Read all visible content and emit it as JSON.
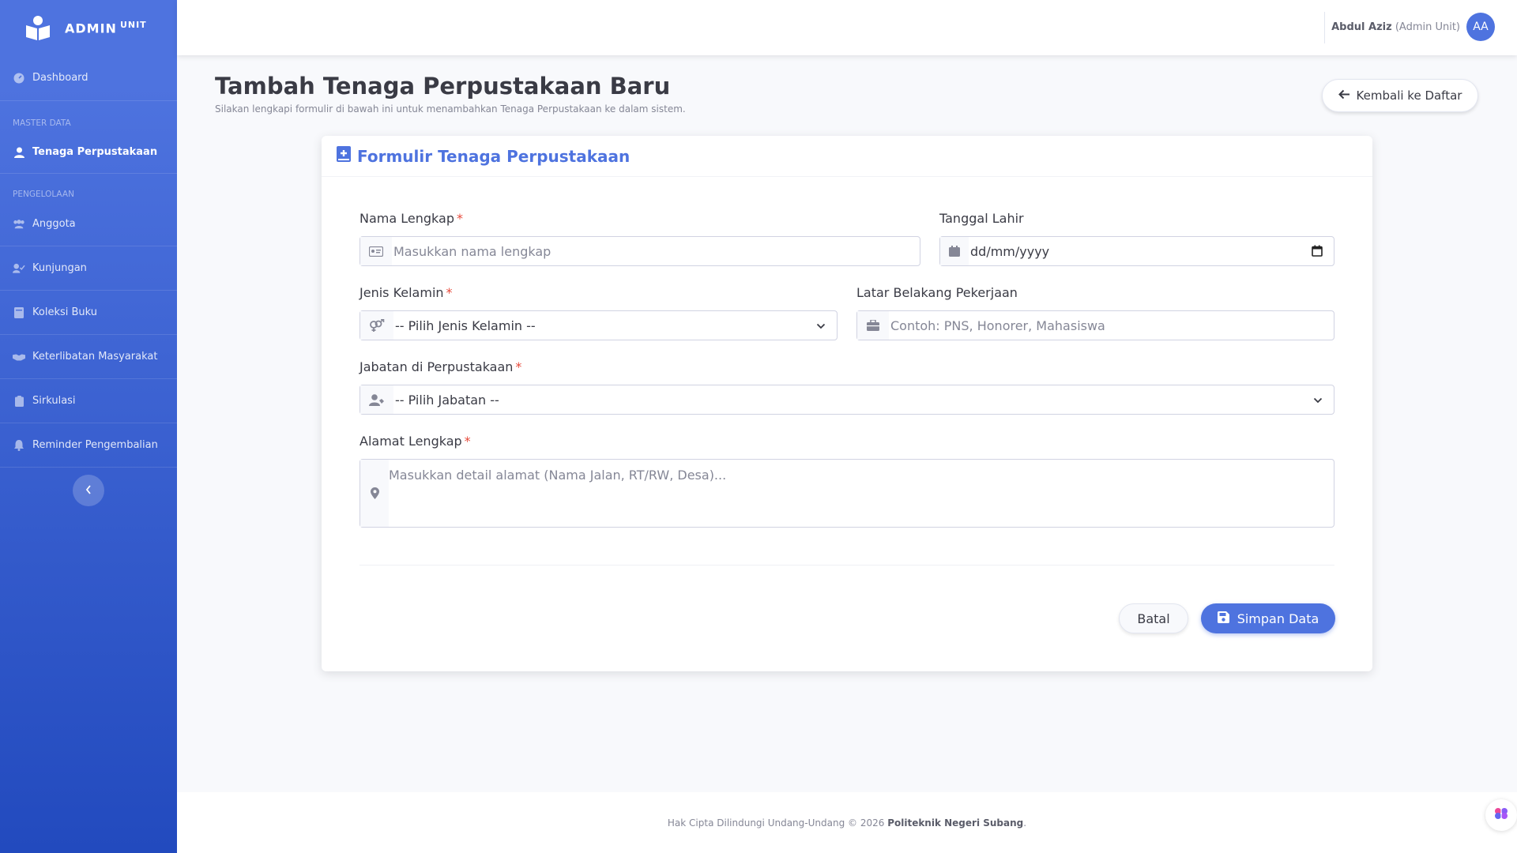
{
  "brand": {
    "name": "ADMIN",
    "suffix": "UNIT",
    "icon": "book-reader-icon"
  },
  "sidebar": {
    "dashboard": "Dashboard",
    "section_master": "MASTER DATA",
    "tenaga": "Tenaga Perpustakaan",
    "section_pengelolaan": "PENGELOLAAN",
    "items": [
      {
        "label": "Anggota",
        "icon": "users-icon"
      },
      {
        "label": "Kunjungan",
        "icon": "user-check-icon"
      },
      {
        "label": "Koleksi Buku",
        "icon": "book-icon"
      },
      {
        "label": "Keterlibatan Masyarakat",
        "icon": "handshake-icon"
      },
      {
        "label": "Sirkulasi",
        "icon": "clipboard-icon"
      },
      {
        "label": "Reminder Pengembalian",
        "icon": "bell-icon"
      }
    ],
    "toggle_icon": "chevron-left-icon"
  },
  "topbar": {
    "user_name": "Abdul Aziz",
    "user_role": "(Admin Unit)",
    "avatar_initials": "AA"
  },
  "page": {
    "title": "Tambah Tenaga Perpustakaan Baru",
    "subtitle": "Silakan lengkapi formulir di bawah ini untuk menambahkan Tenaga Perpustakaan ke dalam sistem.",
    "back_label": "Kembali ke Daftar"
  },
  "form": {
    "title": "Formulir Tenaga Perpustakaan",
    "nama_label": "Nama Lengkap",
    "nama_placeholder": "Masukkan nama lengkap",
    "tanggal_label": "Tanggal Lahir",
    "tanggal_placeholder": "dd/mm/yyyy",
    "jk_label": "Jenis Kelamin",
    "jk_value": "-- Pilih Jenis Kelamin --",
    "pekerjaan_label": "Latar Belakang Pekerjaan",
    "pekerjaan_placeholder": "Contoh: PNS, Honorer, Mahasiswa",
    "jabatan_label": "Jabatan di Perpustakaan",
    "jabatan_value": "-- Pilih Jabatan --",
    "alamat_label": "Alamat Lengkap",
    "alamat_placeholder": "Masukkan detail alamat (Nama Jalan, RT/RW, Desa)...",
    "required_mark": "*",
    "cancel_label": "Batal",
    "save_label": "Simpan Data"
  },
  "footer": {
    "text": "Hak Cipta Dilindungi Undang-Undang © 2026",
    "org": "Politeknik Negeri Subang",
    "end": "."
  },
  "colors": {
    "primary": "#4e73df",
    "danger": "#e74a3b",
    "sidebar_gradient_end": "#224abe"
  }
}
